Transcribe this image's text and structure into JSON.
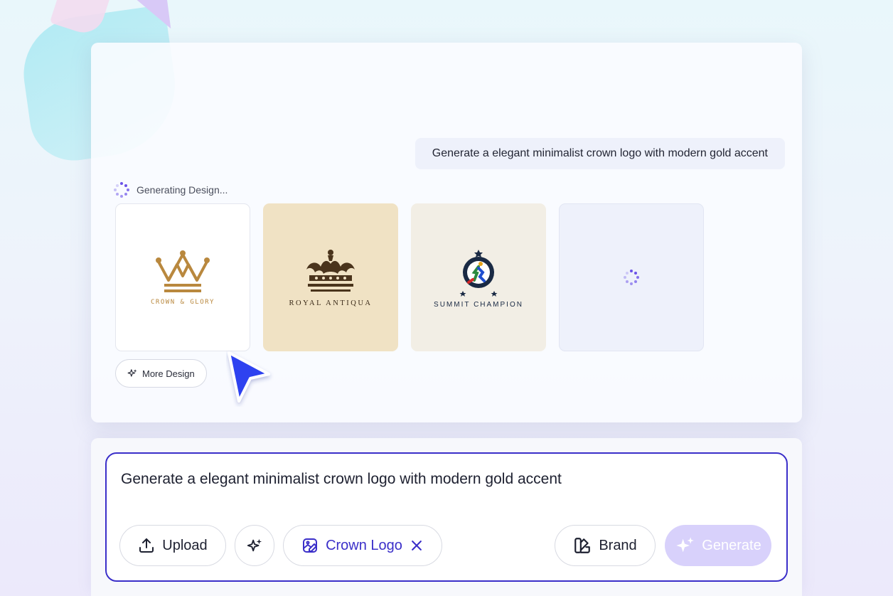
{
  "chat": {
    "user_message": "Generate a elegant minimalist crown logo with modern gold accent",
    "status": "Generating Design..."
  },
  "designs": [
    {
      "name": "CROWN & GLORY",
      "background": "#ffffff",
      "accent": "#b9883e"
    },
    {
      "name": "ROYAL ANTIQUA",
      "background": "#f0e2c4",
      "accent": "#4a341c"
    },
    {
      "name": "SUMMIT CHAMPION",
      "background": "#f2eee5",
      "accent": "#1a2a44"
    },
    {
      "name": "",
      "state": "loading"
    }
  ],
  "more_design_label": "More Design",
  "prompt": {
    "text": "Generate a elegant minimalist crown logo with modern gold accent",
    "upload_label": "Upload",
    "tag_label": "Crown Logo",
    "brand_label": "Brand",
    "generate_label": "Generate"
  },
  "colors": {
    "accent": "#3b2fc9",
    "spinner": "#6b52e8",
    "generate_disabled": "#d8d1fb"
  }
}
